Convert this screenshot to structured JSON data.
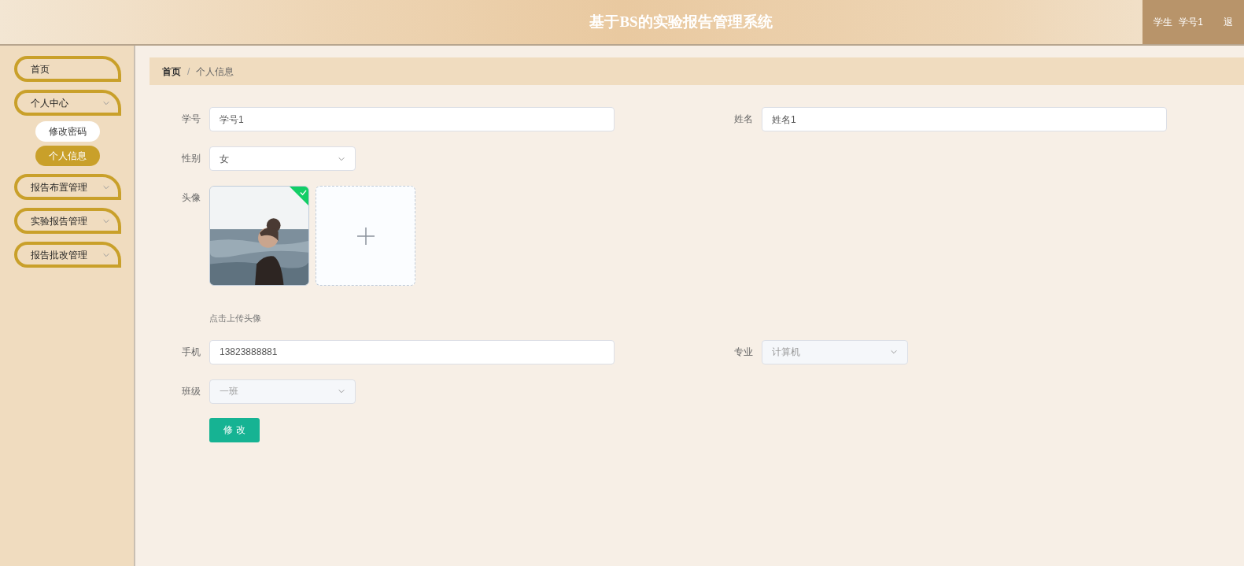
{
  "header": {
    "title": "基于BS的实验报告管理系统",
    "role": "学生",
    "user": "学号1",
    "logout": "退"
  },
  "sidebar": {
    "items": [
      {
        "label": "首页",
        "expandable": false
      },
      {
        "label": "个人中心",
        "expandable": true,
        "children": [
          {
            "label": "修改密码",
            "selected": false
          },
          {
            "label": "个人信息",
            "selected": true
          }
        ]
      },
      {
        "label": "报告布置管理",
        "expandable": true
      },
      {
        "label": "实验报告管理",
        "expandable": true
      },
      {
        "label": "报告批改管理",
        "expandable": true
      }
    ]
  },
  "breadcrumb": {
    "items": [
      "首页",
      "个人信息"
    ],
    "separator": "/"
  },
  "form": {
    "rows": [
      [
        {
          "kind": "text",
          "label": "学号",
          "value": "学号1",
          "disabled": false
        },
        {
          "kind": "text",
          "label": "姓名",
          "value": "姓名1",
          "disabled": false
        }
      ],
      [
        {
          "kind": "select",
          "label": "性别",
          "value": "女",
          "disabled": false
        }
      ],
      [
        {
          "label": "头像",
          "uploaded": true,
          "hint": "点击上传头像"
        }
      ],
      [
        {
          "kind": "text",
          "label": "手机",
          "value": "13823888881",
          "disabled": false
        },
        {
          "kind": "select",
          "label": "专业",
          "value": "计算机",
          "disabled": true
        }
      ],
      [
        {
          "kind": "select",
          "label": "班级",
          "value": "一班",
          "disabled": true
        }
      ]
    ],
    "submit": "修 改"
  }
}
